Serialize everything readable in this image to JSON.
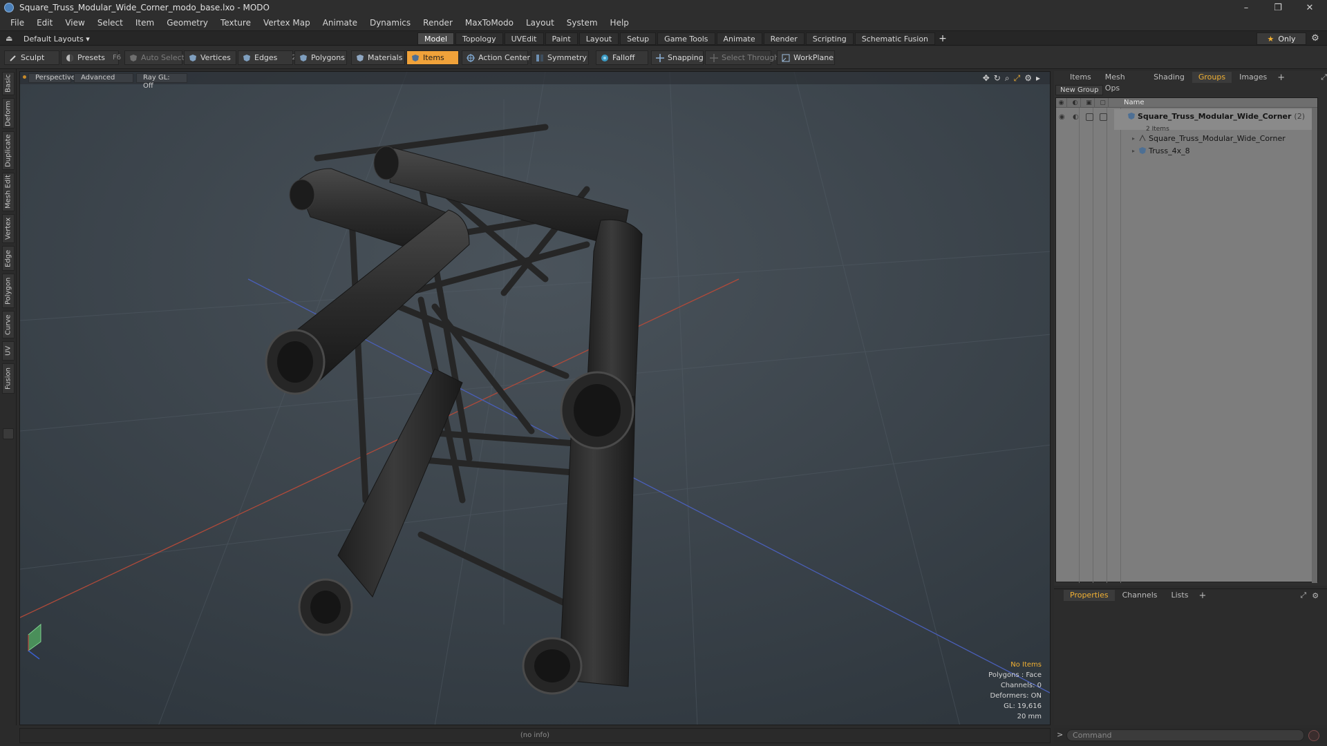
{
  "window": {
    "title": "Square_Truss_Modular_Wide_Corner_modo_base.lxo - MODO",
    "controls": {
      "minimize": "–",
      "restore": "❐",
      "close": "✕"
    }
  },
  "menu": [
    "File",
    "Edit",
    "View",
    "Select",
    "Item",
    "Geometry",
    "Texture",
    "Vertex Map",
    "Animate",
    "Dynamics",
    "Render",
    "MaxToModo",
    "Layout",
    "System",
    "Help"
  ],
  "layout_selector": "Default Layouts ▾",
  "tabs": [
    {
      "label": "Model",
      "active": true
    },
    {
      "label": "Topology",
      "active": false
    },
    {
      "label": "UVEdit",
      "active": false
    },
    {
      "label": "Paint",
      "active": false
    },
    {
      "label": "Layout",
      "active": false
    },
    {
      "label": "Setup",
      "active": false
    },
    {
      "label": "Game Tools",
      "active": false
    },
    {
      "label": "Animate",
      "active": false
    },
    {
      "label": "Render",
      "active": false
    },
    {
      "label": "Scripting",
      "active": false
    },
    {
      "label": "Schematic Fusion",
      "active": false
    }
  ],
  "tab_add": "+",
  "only_label": "Only",
  "toolbar": {
    "sculpt": "Sculpt",
    "presets": "Presets",
    "presets_key": "F6",
    "auto_select": "Auto Select",
    "vertices": "Vertices",
    "vertices_key": "1",
    "edges": "Edges",
    "edges_key": "2",
    "polygons": "Polygons",
    "materials": "Materials",
    "items": "Items",
    "action_center": "Action Center",
    "symmetry": "Symmetry",
    "falloff": "Falloff",
    "snapping": "Snapping",
    "select_through": "Select Through",
    "workplane": "WorkPlane"
  },
  "vertical_tabs": [
    "Basic",
    "Deform",
    "Duplicate",
    "Mesh Edit",
    "Vertex",
    "Edge",
    "Polygon",
    "Curve",
    "UV",
    "Fusion"
  ],
  "viewport": {
    "view": "Perspective",
    "shading": "Advanced",
    "raygl": "Ray GL: Off",
    "info": {
      "selection": "No Items",
      "polygons": "Polygons : Face",
      "channels": "Channels: 0",
      "deformers": "Deformers: ON",
      "gl": "GL: 19,616",
      "scale": "20 mm"
    }
  },
  "status": "(no info)",
  "right_panel": {
    "tabs": [
      {
        "label": "Items",
        "active": false
      },
      {
        "label": "Mesh Ops",
        "active": false
      },
      {
        "label": "Shading",
        "active": false
      },
      {
        "label": "Groups",
        "active": true
      },
      {
        "label": "Images",
        "active": false
      }
    ],
    "tab_add": "+",
    "new_group": "New Group",
    "column_name": "Name",
    "group": {
      "name": "Square_Truss_Modular_Wide_Corner",
      "count": "(2)",
      "subtitle": "2 Items",
      "children": [
        "Square_Truss_Modular_Wide_Corner",
        "Truss_4x_8"
      ]
    }
  },
  "properties_panel": {
    "tabs": [
      {
        "label": "Properties",
        "active": true
      },
      {
        "label": "Channels",
        "active": false
      },
      {
        "label": "Lists",
        "active": false
      }
    ],
    "tab_add": "+"
  },
  "command": {
    "prompt": ">",
    "placeholder": "Command"
  }
}
